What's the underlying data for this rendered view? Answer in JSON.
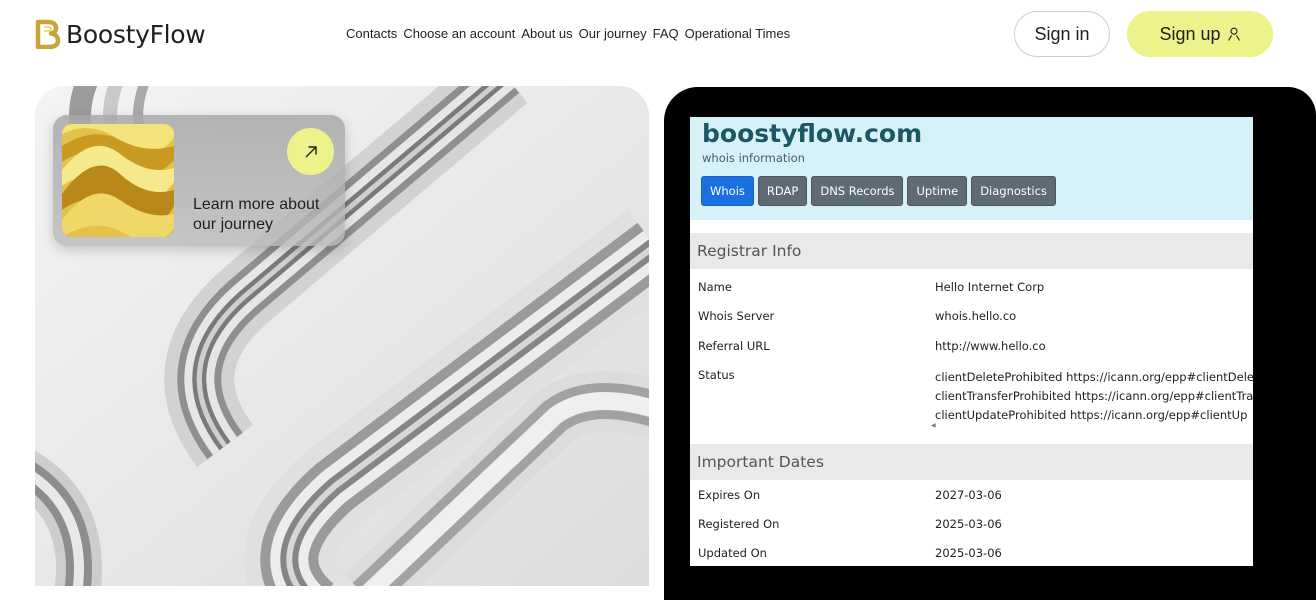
{
  "header": {
    "brand": "BoostyFlow",
    "nav": [
      "Contacts",
      "Choose an account",
      "About us",
      "Our journey",
      "FAQ",
      "Operational Times"
    ],
    "sign_in": "Sign in",
    "sign_up": "Sign up"
  },
  "hero": {
    "card_text": "Learn more about our journey"
  },
  "whois": {
    "domain": "boostyflow.com",
    "subtitle": "whois information",
    "tabs": [
      "Whois",
      "RDAP",
      "DNS Records",
      "Uptime",
      "Diagnostics"
    ],
    "active_tab": "Whois",
    "registrar_heading": "Registrar Info",
    "registrar": [
      {
        "key": "Name",
        "value": "Hello Internet Corp"
      },
      {
        "key": "Whois Server",
        "value": "whois.hello.co"
      },
      {
        "key": "Referral URL",
        "value": "http://www.hello.co"
      }
    ],
    "status_label": "Status",
    "status_lines": [
      "clientDeleteProhibited https://icann.org/epp#clientDele",
      "clientTransferProhibited https://icann.org/epp#clientTra",
      "clientUpdateProhibited https://icann.org/epp#clientUp"
    ],
    "dates_heading": "Important Dates",
    "dates": [
      {
        "key": "Expires On",
        "value": "2027-03-06"
      },
      {
        "key": "Registered On",
        "value": "2025-03-06"
      },
      {
        "key": "Updated On",
        "value": "2025-03-06"
      }
    ]
  },
  "colors": {
    "accent": "#edf38a",
    "whois_header_bg": "#d6f1f8",
    "domain_text": "#1d5667",
    "active_tab": "#1c6fe0",
    "tab": "#5f6b74"
  },
  "icons": {
    "logo": "brand-logo-icon",
    "sign_up": "user-icon",
    "card_arrow": "arrow-up-right-icon"
  }
}
